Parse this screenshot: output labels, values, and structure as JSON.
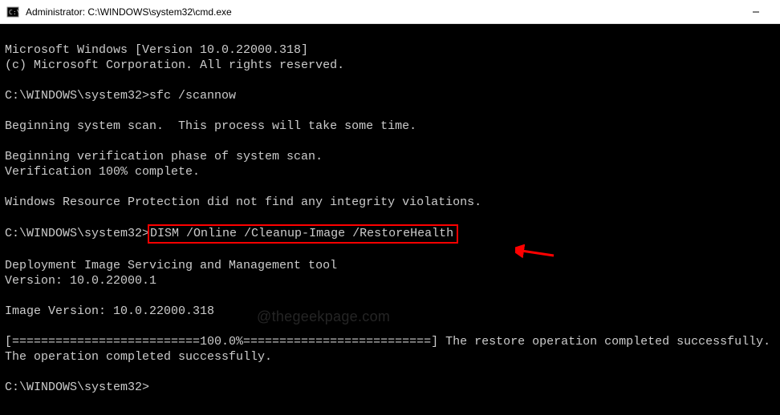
{
  "window": {
    "title": "Administrator: C:\\WINDOWS\\system32\\cmd.exe"
  },
  "terminal": {
    "line_version": "Microsoft Windows [Version 10.0.22000.318]",
    "line_copyright": "(c) Microsoft Corporation. All rights reserved.",
    "prompt1_path": "C:\\WINDOWS\\system32>",
    "prompt1_cmd": "sfc /scannow",
    "line_scan1": "Beginning system scan.  This process will take some time.",
    "line_scan2": "Beginning verification phase of system scan.",
    "line_scan3": "Verification 100% complete.",
    "line_result": "Windows Resource Protection did not find any integrity violations.",
    "prompt2_path": "C:\\WINDOWS\\system32>",
    "prompt2_cmd": "DISM /Online /Cleanup-Image /RestoreHealth",
    "line_dism1": "Deployment Image Servicing and Management tool",
    "line_dism2": "Version: 10.0.22000.1",
    "line_dism3": "Image Version: 10.0.22000.318",
    "line_progress": "[==========================100.0%==========================] The restore operation completed successfully.",
    "line_done": "The operation completed successfully.",
    "prompt3_path": "C:\\WINDOWS\\system32>"
  },
  "watermark": "@thegeekpage.com"
}
